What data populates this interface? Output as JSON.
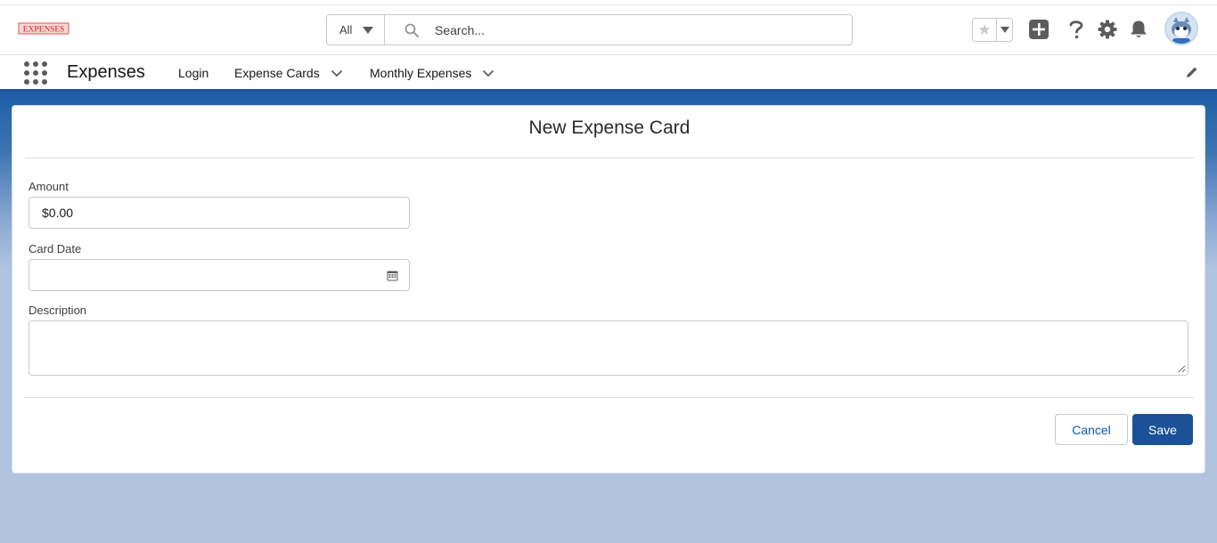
{
  "app": {
    "logo_text": "EXPENSES",
    "name": "Expenses"
  },
  "search": {
    "scope": "All",
    "placeholder": "Search..."
  },
  "nav": {
    "items": [
      {
        "label": "Login",
        "has_menu": false
      },
      {
        "label": "Expense Cards",
        "has_menu": true
      },
      {
        "label": "Monthly Expenses",
        "has_menu": true
      }
    ]
  },
  "form": {
    "title": "New Expense Card",
    "fields": {
      "amount": {
        "label": "Amount",
        "value": "$0.00"
      },
      "card_date": {
        "label": "Card Date",
        "value": ""
      },
      "description": {
        "label": "Description",
        "value": ""
      }
    },
    "buttons": {
      "cancel": "Cancel",
      "save": "Save"
    }
  },
  "icons": [
    "favorite-star-icon",
    "chevron-down-icon",
    "global-add-icon",
    "help-icon",
    "setup-gear-icon",
    "notification-bell-icon",
    "avatar",
    "app-launcher-icon",
    "edit-pencil-icon",
    "search-icon",
    "calendar-icon",
    "resize-handle-icon"
  ],
  "colors": {
    "brand": "#1b5297",
    "background": "#b0c4df",
    "logo_red": "#d9534f"
  }
}
